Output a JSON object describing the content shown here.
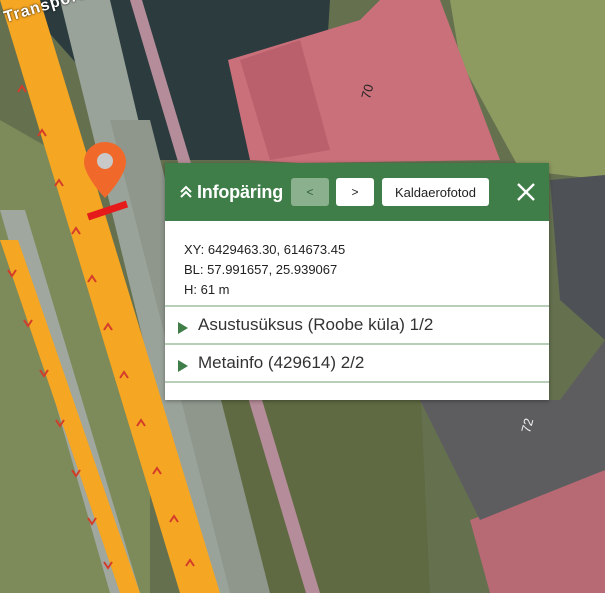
{
  "map": {
    "street_label": "Transpordi",
    "house_numbers": [
      "70",
      "72"
    ]
  },
  "infopanel": {
    "title": "Infopäring",
    "prev_label": "<",
    "next_label": ">",
    "aerial_button": "Kaldaerofotod",
    "coords": {
      "xy": "XY: 6429463.30, 614673.45",
      "bl": "BL: 57.991657, 25.939067",
      "h": "H: 61 m"
    },
    "sections": [
      {
        "label": "Asustusüksus (Roobe küla) 1/2"
      },
      {
        "label": "Metainfo (429614) 2/2"
      }
    ]
  },
  "colors": {
    "header": "#3f7e48",
    "marker": "#f0692b",
    "road": "#f5a623",
    "roof": "#c9707a"
  },
  "icons": [
    "double-chevron-up-icon",
    "close-icon",
    "caret-right-icon",
    "map-pin-icon"
  ]
}
